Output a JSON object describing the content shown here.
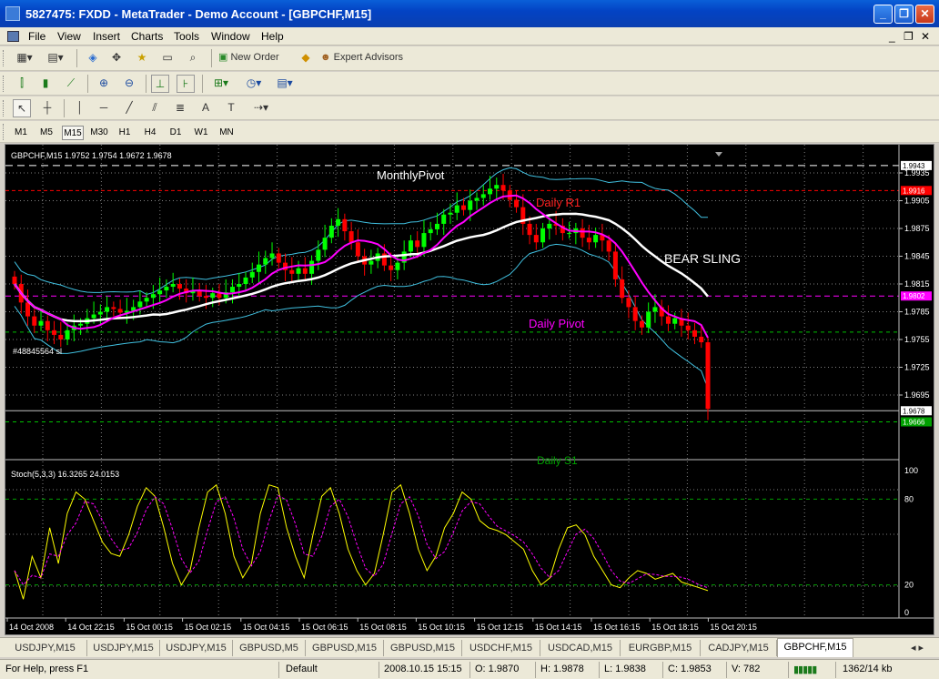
{
  "window": {
    "title": "5827475: FXDD - MetaTrader - Demo Account - [GBPCHF,M15]",
    "minimize": "_",
    "restore": "❐",
    "close": "✕"
  },
  "menu": [
    "File",
    "View",
    "Insert",
    "Charts",
    "Tools",
    "Window",
    "Help"
  ],
  "toolbar": {
    "new_order": "New Order",
    "expert_advisors": "Expert Advisors"
  },
  "timeframes": [
    "M1",
    "M5",
    "M15",
    "M30",
    "H1",
    "H4",
    "D1",
    "W1",
    "MN"
  ],
  "active_timeframe": "M15",
  "chart": {
    "header": "GBPCHF,M15  1.9752 1.9754 1.9672 1.9678",
    "stoch_header": "Stoch(5,3,3) 16.3265 24.0153",
    "monthly_pivot": "MonthlyPivot",
    "daily_r1": "Daily R1",
    "bear_sling": "BEAR SLING",
    "daily_pivot": "Daily Pivot",
    "daily_s1": "Daily S1",
    "left_label": "#48845564 sl",
    "price_ticks": [
      "1.9935",
      "1.9905",
      "1.9875",
      "1.9845",
      "1.9815",
      "1.9785",
      "1.9755",
      "1.9725",
      "1.9695"
    ],
    "price_boxes": [
      {
        "value": "1.9943",
        "bg": "#ffffff",
        "fg": "#000000"
      },
      {
        "value": "1.9916",
        "bg": "#ff0000",
        "fg": "#ffffff"
      },
      {
        "value": "1.9802",
        "bg": "#ff00ff",
        "fg": "#ffffff"
      },
      {
        "value": "1.9678",
        "bg": "#ffffff",
        "fg": "#000000"
      },
      {
        "value": "1.9666",
        "bg": "#00a000",
        "fg": "#ffffff"
      }
    ],
    "stoch_ticks": [
      "100",
      "80",
      "20",
      "0"
    ],
    "time_labels": [
      "14 Oct 2008",
      "14 Oct 22:15",
      "15 Oct 00:15",
      "15 Oct 02:15",
      "15 Oct 04:15",
      "15 Oct 06:15",
      "15 Oct 08:15",
      "15 Oct 10:15",
      "15 Oct 12:15",
      "15 Oct 14:15",
      "15 Oct 16:15",
      "15 Oct 18:15",
      "15 Oct 20:15"
    ],
    "colors": {
      "bull": "#00ff00",
      "bear": "#ff0000",
      "ma_white": "#ffffff",
      "ma_magenta": "#ff00ff",
      "bollinger": "#40c0e0",
      "stoch_main": "#ffff00",
      "stoch_signal": "#ff00ff",
      "grid": "#808080"
    }
  },
  "tabs": [
    "USDJPY,M15",
    "USDJPY,M15",
    "USDJPY,M15",
    "GBPUSD,M5",
    "GBPUSD,M15",
    "GBPUSD,M15",
    "USDCHF,M15",
    "USDCAD,M15",
    "EURGBP,M15",
    "CADJPY,M15",
    "GBPCHF,M15"
  ],
  "active_tab": "GBPCHF,M15",
  "status": {
    "help": "For Help, press F1",
    "profile": "Default",
    "datetime": "2008.10.15 15:15",
    "open": "O: 1.9870",
    "high": "H: 1.9878",
    "low": "L: 1.9838",
    "close": "C: 1.9853",
    "volume": "V: 782",
    "traffic": "1362/14 kb"
  }
}
